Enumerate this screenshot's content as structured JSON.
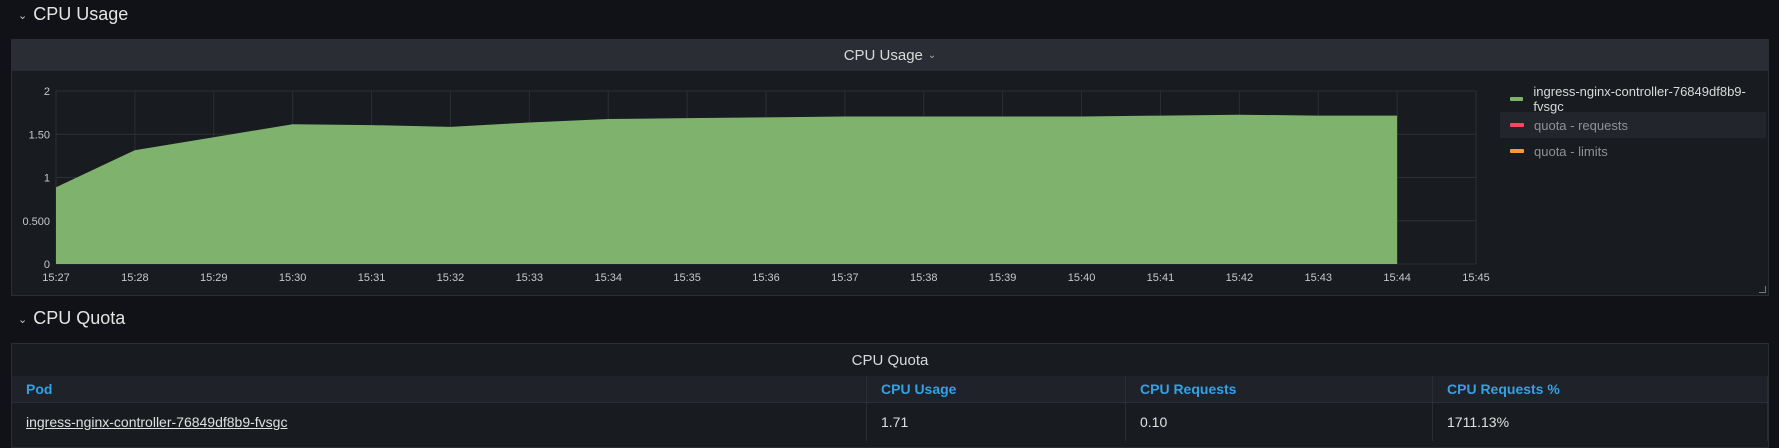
{
  "rows": {
    "usage_title": "CPU Usage",
    "quota_title": "CPU Quota"
  },
  "usage_panel": {
    "title": "CPU Usage",
    "legend": [
      {
        "label": "ingress-nginx-controller-76849df8b9-fvsgc",
        "color": "#7eb26d"
      },
      {
        "label": "quota - requests",
        "color": "#f2495c"
      },
      {
        "label": "quota - limits",
        "color": "#ff9830"
      }
    ]
  },
  "chart_data": {
    "type": "area",
    "title": "CPU Usage",
    "x": [
      "15:27",
      "15:28",
      "15:29",
      "15:30",
      "15:31",
      "15:32",
      "15:33",
      "15:34",
      "15:35",
      "15:36",
      "15:37",
      "15:38",
      "15:39",
      "15:40",
      "15:41",
      "15:42",
      "15:43",
      "15:44"
    ],
    "x_ticks": [
      "15:27",
      "15:28",
      "15:29",
      "15:30",
      "15:31",
      "15:32",
      "15:33",
      "15:34",
      "15:35",
      "15:36",
      "15:37",
      "15:38",
      "15:39",
      "15:40",
      "15:41",
      "15:42",
      "15:43",
      "15:44",
      "15:45"
    ],
    "y_ticks": [
      "0",
      "0.500",
      "1",
      "1.50",
      "2"
    ],
    "ylim": [
      0,
      2
    ],
    "series": [
      {
        "name": "ingress-nginx-controller-76849df8b9-fvsgc",
        "color": "#7eb26d",
        "values": [
          0.88,
          1.31,
          1.46,
          1.61,
          1.6,
          1.58,
          1.63,
          1.67,
          1.68,
          1.69,
          1.7,
          1.7,
          1.7,
          1.7,
          1.71,
          1.72,
          1.71,
          1.71
        ]
      }
    ]
  },
  "quota_panel": {
    "title": "CPU Quota",
    "columns": [
      "Pod",
      "CPU Usage",
      "CPU Requests",
      "CPU Requests %"
    ],
    "rows": [
      [
        "ingress-nginx-controller-76849df8b9-fvsgc",
        "1.71",
        "0.10",
        "1711.13%"
      ]
    ]
  }
}
